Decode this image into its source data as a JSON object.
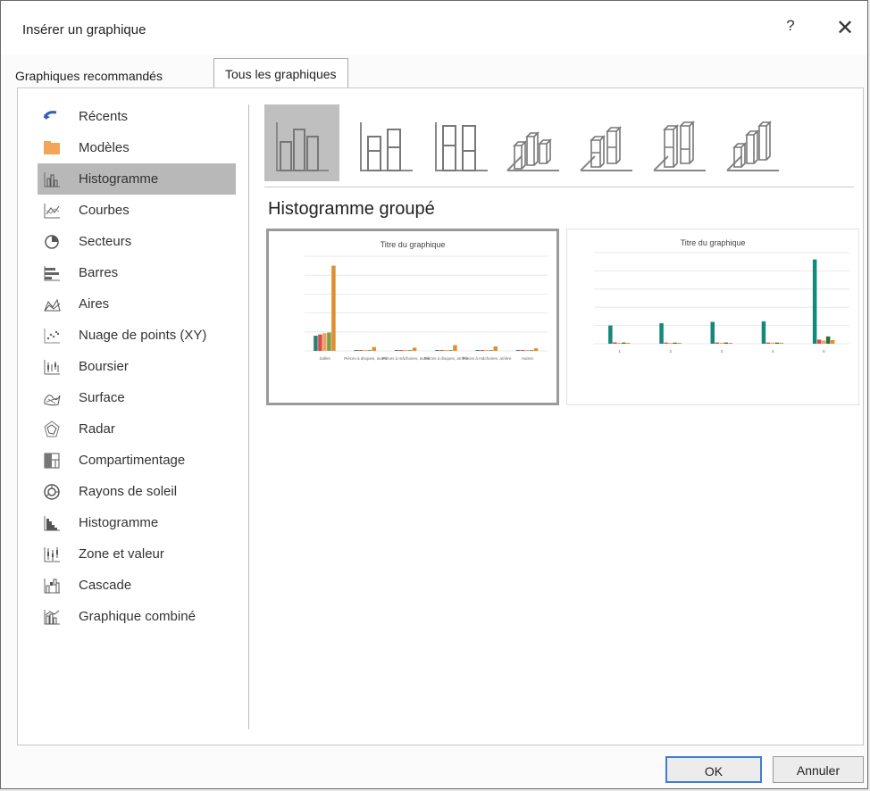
{
  "dialog": {
    "title": "Insérer un graphique",
    "help": "?",
    "close": "✕"
  },
  "tabs": [
    {
      "label": "Graphiques recommandés"
    },
    {
      "label": "Tous les graphiques"
    }
  ],
  "sidebar": {
    "items": [
      {
        "label": "Récents",
        "icon": "recent-icon"
      },
      {
        "label": "Modèles",
        "icon": "folder-icon"
      },
      {
        "label": "Histogramme",
        "icon": "column-chart-icon",
        "selected": true
      },
      {
        "label": "Courbes",
        "icon": "line-chart-icon"
      },
      {
        "label": "Secteurs",
        "icon": "pie-chart-icon"
      },
      {
        "label": "Barres",
        "icon": "bar-chart-icon"
      },
      {
        "label": "Aires",
        "icon": "area-chart-icon"
      },
      {
        "label": "Nuage de points (XY)",
        "icon": "scatter-chart-icon"
      },
      {
        "label": "Boursier",
        "icon": "stock-chart-icon"
      },
      {
        "label": "Surface",
        "icon": "surface-chart-icon"
      },
      {
        "label": "Radar",
        "icon": "radar-chart-icon"
      },
      {
        "label": "Compartimentage",
        "icon": "treemap-icon"
      },
      {
        "label": "Rayons de soleil",
        "icon": "sunburst-icon"
      },
      {
        "label": "Histogramme",
        "icon": "histogram-icon"
      },
      {
        "label": "Zone et valeur",
        "icon": "box-whisker-icon"
      },
      {
        "label": "Cascade",
        "icon": "waterfall-icon"
      },
      {
        "label": "Graphique combiné",
        "icon": "combo-chart-icon"
      }
    ]
  },
  "subtype_title": "Histogramme groupé",
  "previews": [
    {
      "title": "Titre du graphique",
      "chart_data": {
        "type": "bar",
        "title": "Titre du graphique",
        "categories": [
          "Salles",
          "Pièces à disques, avant",
          "Pièces à mâchoires, avant",
          "Pièces à disques, arrière",
          "Pièces à mâchoires, arrière",
          "Autres"
        ],
        "series": [
          {
            "values": [
              2400,
              100,
              80,
              120,
              90,
              70
            ],
            "color": "#2e7d73"
          },
          {
            "values": [
              2600,
              80,
              70,
              90,
              80,
              60
            ],
            "color": "#d64c4c"
          },
          {
            "values": [
              2800,
              60,
              60,
              70,
              60,
              50
            ],
            "color": "#f0a25c"
          },
          {
            "values": [
              2900,
              90,
              80,
              100,
              70,
              60
            ],
            "color": "#7a9e4b"
          },
          {
            "values": [
              13500,
              600,
              500,
              900,
              700,
              400
            ],
            "color": "#e08e2e"
          }
        ],
        "ylim": [
          0,
          15000
        ]
      }
    },
    {
      "title": "Titre du graphique",
      "chart_data": {
        "type": "bar",
        "title": "Titre du graphique",
        "categories": [
          "1",
          "2",
          "3",
          "4",
          "5"
        ],
        "series": [
          {
            "values": [
              4000,
              4500,
              4800,
              4900,
              18500
            ],
            "color": "#13897a"
          },
          {
            "values": [
              300,
              250,
              280,
              260,
              900
            ],
            "color": "#d64c4c"
          },
          {
            "values": [
              200,
              180,
              220,
              240,
              700
            ],
            "color": "#f0a25c"
          },
          {
            "values": [
              250,
              230,
              260,
              250,
              1600
            ],
            "color": "#2d6f35"
          },
          {
            "values": [
              150,
              140,
              170,
              160,
              800
            ],
            "color": "#e08e2e"
          }
        ],
        "ylim": [
          0,
          20000
        ]
      }
    }
  ],
  "footer": {
    "ok": "OK",
    "cancel": "Annuler"
  }
}
